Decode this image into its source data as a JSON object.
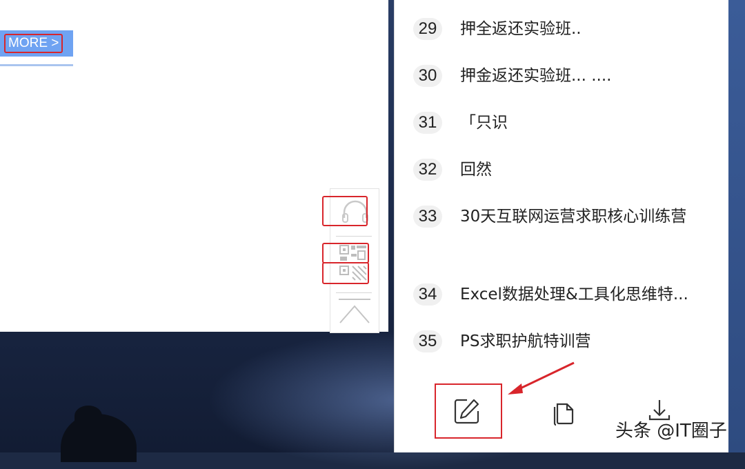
{
  "webpage": {
    "more_button_label": "MORE >"
  },
  "float_toolbar": {
    "items": [
      {
        "icon": "headphones-icon"
      },
      {
        "icon": "qr-code-icon"
      },
      {
        "icon": "qr-code-icon"
      },
      {
        "icon": "back-to-top-icon"
      }
    ]
  },
  "panel": {
    "items": [
      {
        "num": "29",
        "title": "押全返还实验班.."
      },
      {
        "num": "30",
        "title": "押金返还实验班... ...."
      },
      {
        "num": "31",
        "title": "「只识"
      },
      {
        "num": "32",
        "title": "回然"
      },
      {
        "num": "33",
        "title": "30天互联网运营求职核心训练营"
      },
      {
        "num": "34",
        "title": "Excel数据处理&工具化思维特..."
      },
      {
        "num": "35",
        "title": "PS求职护航特训营"
      }
    ],
    "bottom_actions": [
      {
        "icon": "edit-icon"
      },
      {
        "icon": "copy-icon"
      },
      {
        "icon": "download-icon"
      }
    ]
  },
  "annotation_color": "#d8252b",
  "watermark": "头条 @IT圈子"
}
